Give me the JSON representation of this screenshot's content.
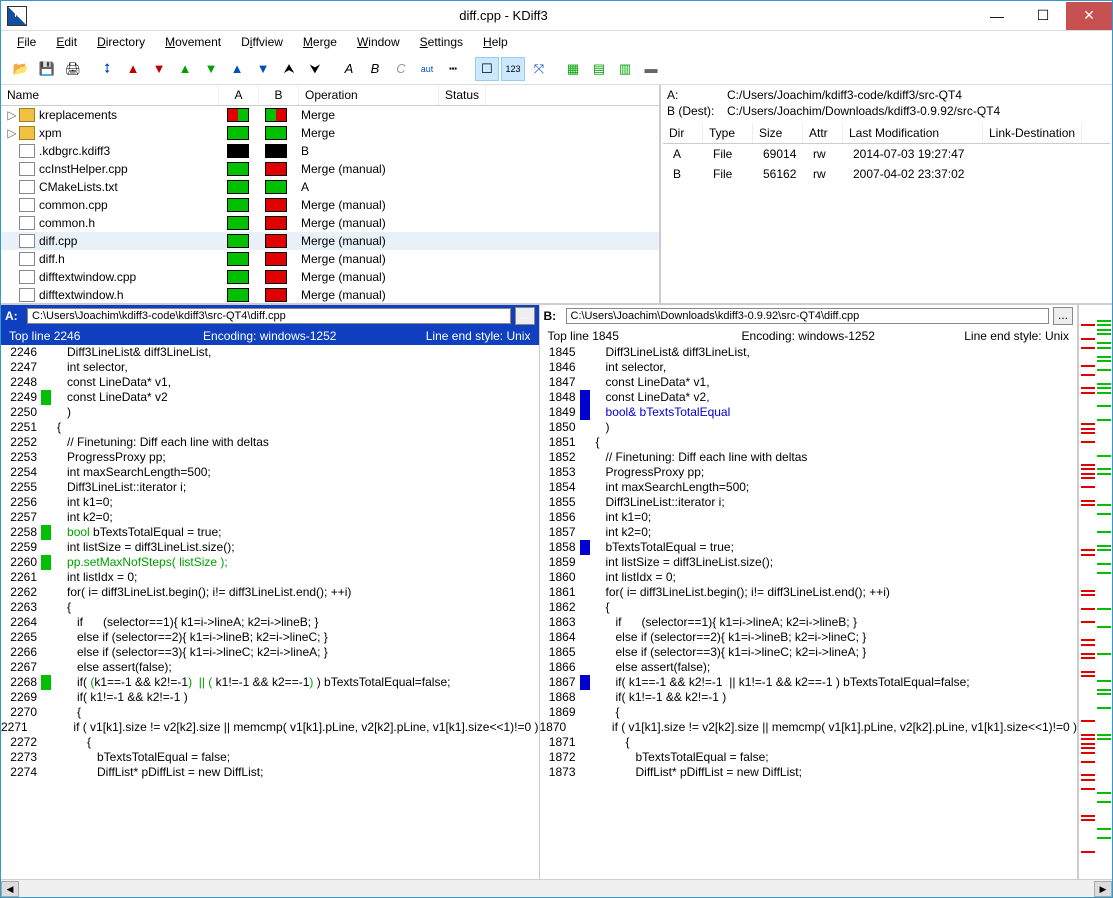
{
  "window": {
    "title": "diff.cpp - KDiff3"
  },
  "menus": [
    "File",
    "Edit",
    "Directory",
    "Movement",
    "Diffview",
    "Merge",
    "Window",
    "Settings",
    "Help"
  ],
  "tree": {
    "headers": {
      "name": "Name",
      "a": "A",
      "b": "B",
      "op": "Operation",
      "status": "Status"
    },
    "rows": [
      {
        "type": "folder",
        "exp": "▷",
        "name": "kreplacements",
        "a": "rg",
        "b": "gr",
        "op": "Merge"
      },
      {
        "type": "folder",
        "exp": "▷",
        "name": "xpm",
        "a": "green",
        "b": "green",
        "op": "Merge"
      },
      {
        "type": "file",
        "name": ".kdbgrc.kdiff3",
        "a": "black",
        "b": "black",
        "op": "B"
      },
      {
        "type": "file",
        "name": "ccInstHelper.cpp",
        "a": "green",
        "b": "red",
        "op": "Merge (manual)"
      },
      {
        "type": "file",
        "name": "CMakeLists.txt",
        "a": "green",
        "b": "green",
        "op": "A"
      },
      {
        "type": "file",
        "name": "common.cpp",
        "a": "green",
        "b": "red",
        "op": "Merge (manual)"
      },
      {
        "type": "file",
        "name": "common.h",
        "a": "green",
        "b": "red",
        "op": "Merge (manual)"
      },
      {
        "type": "file",
        "name": "diff.cpp",
        "a": "green",
        "b": "red",
        "op": "Merge (manual)",
        "selected": true
      },
      {
        "type": "file",
        "name": "diff.h",
        "a": "green",
        "b": "red",
        "op": "Merge (manual)"
      },
      {
        "type": "file",
        "name": "difftextwindow.cpp",
        "a": "green",
        "b": "red",
        "op": "Merge (manual)"
      },
      {
        "type": "file",
        "name": "difftextwindow.h",
        "a": "green",
        "b": "red",
        "op": "Merge (manual)"
      }
    ]
  },
  "info": {
    "a_label": "A:",
    "a_path": "C:/Users/Joachim/kdiff3-code/kdiff3/src-QT4",
    "b_label": "B (Dest):",
    "b_path": "C:/Users/Joachim/Downloads/kdiff3-0.9.92/src-QT4",
    "headers": {
      "dir": "Dir",
      "type": "Type",
      "size": "Size",
      "attr": "Attr",
      "mod": "Last Modification",
      "link": "Link-Destination"
    },
    "rows": [
      {
        "dir": "A",
        "type": "File",
        "size": "69014",
        "attr": "rw",
        "mod": "2014-07-03 19:27:47"
      },
      {
        "dir": "B",
        "type": "File",
        "size": "56162",
        "attr": "rw",
        "mod": "2007-04-02 23:37:02"
      }
    ]
  },
  "paneA": {
    "label": "A:",
    "path": "C:\\Users\\Joachim\\kdiff3-code\\kdiff3\\src-QT4\\diff.cpp",
    "topline": "Top line 2246",
    "encoding": "Encoding: windows-1252",
    "eol": "Line end style: Unix",
    "lines": [
      {
        "n": "2246",
        "m": "",
        "t": "   Diff3LineList& diff3LineList,"
      },
      {
        "n": "2247",
        "m": "",
        "t": "   int selector,"
      },
      {
        "n": "2248",
        "m": "",
        "t": "   const LineData* v1,"
      },
      {
        "n": "2249",
        "m": "g",
        "t": "   const LineData* v2"
      },
      {
        "n": "",
        "m": "g",
        "t": ""
      },
      {
        "n": "2250",
        "m": "",
        "t": "   )"
      },
      {
        "n": "2251",
        "m": "",
        "t": "{"
      },
      {
        "n": "2252",
        "m": "",
        "t": "   // Finetuning: Diff each line with deltas"
      },
      {
        "n": "2253",
        "m": "",
        "t": "   ProgressProxy pp;"
      },
      {
        "n": "2254",
        "m": "",
        "t": "   int maxSearchLength=500;"
      },
      {
        "n": "2255",
        "m": "",
        "t": "   Diff3LineList::iterator i;"
      },
      {
        "n": "2256",
        "m": "",
        "t": "   int k1=0;"
      },
      {
        "n": "2257",
        "m": "",
        "t": "   int k2=0;"
      },
      {
        "n": "2258",
        "m": "g",
        "t": "   <g>bool</g> bTextsTotalEqual = true;"
      },
      {
        "n": "2259",
        "m": "",
        "t": "   int listSize = diff3LineList.size();"
      },
      {
        "n": "2260",
        "m": "g",
        "t": "   <g>pp.setMaxNofSteps( listSize );</g>"
      },
      {
        "n": "2261",
        "m": "",
        "t": "   int listIdx = 0;"
      },
      {
        "n": "2262",
        "m": "",
        "t": "   for( i= diff3LineList.begin(); i!= diff3LineList.end(); ++i)"
      },
      {
        "n": "2263",
        "m": "",
        "t": "   {"
      },
      {
        "n": "2264",
        "m": "",
        "t": "      if      (selector==1){ k1=i->lineA; k2=i->lineB; }"
      },
      {
        "n": "2265",
        "m": "",
        "t": "      else if (selector==2){ k1=i->lineB; k2=i->lineC; }"
      },
      {
        "n": "2266",
        "m": "",
        "t": "      else if (selector==3){ k1=i->lineC; k2=i->lineA; }"
      },
      {
        "n": "2267",
        "m": "",
        "t": "      else assert(false);"
      },
      {
        "n": "2268",
        "m": "g",
        "t": "      if( <g>(</g>k1==-1 && k2!=-1<g>)  || (</g> k1!=-1 && k2==-1<g>)</g> ) bTextsTotalEqual=false;"
      },
      {
        "n": "2269",
        "m": "",
        "t": "      if( k1!=-1 && k2!=-1 )"
      },
      {
        "n": "2270",
        "m": "",
        "t": "      {"
      },
      {
        "n": "2271",
        "m": "",
        "t": "         if ( v1[k1].size != v2[k2].size || memcmp( v1[k1].pLine, v2[k2].pLine, v1[k1].size<<1)!=0 )"
      },
      {
        "n": "2272",
        "m": "",
        "t": "         {"
      },
      {
        "n": "2273",
        "m": "",
        "t": "            bTextsTotalEqual = false;"
      },
      {
        "n": "2274",
        "m": "",
        "t": "            DiffList* pDiffList = new DiffList;"
      }
    ]
  },
  "paneB": {
    "label": "B:",
    "path": "C:\\Users\\Joachim\\Downloads\\kdiff3-0.9.92\\src-QT4\\diff.cpp",
    "topline": "Top line 1845",
    "encoding": "Encoding: windows-1252",
    "eol": "Line end style: Unix",
    "lines": [
      {
        "n": "1845",
        "m": "",
        "t": "   Diff3LineList& diff3LineList,"
      },
      {
        "n": "1846",
        "m": "",
        "t": "   int selector,"
      },
      {
        "n": "1847",
        "m": "",
        "t": "   const LineData* v1,"
      },
      {
        "n": "1848",
        "m": "b",
        "t": "   const LineData* v2<b>,</b>"
      },
      {
        "n": "1849",
        "m": "b",
        "t": "   <b>bool& bTextsTotalEqual</b>"
      },
      {
        "n": "1850",
        "m": "",
        "t": "   )"
      },
      {
        "n": "1851",
        "m": "",
        "t": "{"
      },
      {
        "n": "1852",
        "m": "",
        "t": "   // Finetuning: Diff each line with deltas"
      },
      {
        "n": "1853",
        "m": "",
        "t": "   ProgressProxy pp;"
      },
      {
        "n": "1854",
        "m": "",
        "t": "   int maxSearchLength=500;"
      },
      {
        "n": "1855",
        "m": "",
        "t": "   Diff3LineList::iterator i;"
      },
      {
        "n": "1856",
        "m": "",
        "t": "   int k1=0;"
      },
      {
        "n": "1857",
        "m": "",
        "t": "   int k2=0;"
      },
      {
        "n": "1858",
        "m": "b",
        "t": "   bTextsTotalEqual = true;"
      },
      {
        "n": "1859",
        "m": "",
        "t": "   int listSize = diff3LineList.size();"
      },
      {
        "n": "",
        "m": "b",
        "t": ""
      },
      {
        "n": "1860",
        "m": "",
        "t": "   int listIdx = 0;"
      },
      {
        "n": "1861",
        "m": "",
        "t": "   for( i= diff3LineList.begin(); i!= diff3LineList.end(); ++i)"
      },
      {
        "n": "1862",
        "m": "",
        "t": "   {"
      },
      {
        "n": "1863",
        "m": "",
        "t": "      if      (selector==1){ k1=i->lineA; k2=i->lineB; }"
      },
      {
        "n": "1864",
        "m": "",
        "t": "      else if (selector==2){ k1=i->lineB; k2=i->lineC; }"
      },
      {
        "n": "1865",
        "m": "",
        "t": "      else if (selector==3){ k1=i->lineC; k2=i->lineA; }"
      },
      {
        "n": "1866",
        "m": "",
        "t": "      else assert(false);"
      },
      {
        "n": "1867",
        "m": "b",
        "t": "      if( k1==-1 && k2!=-1  || k1!=-1 && k2==-1 ) bTextsTotalEqual=false;"
      },
      {
        "n": "1868",
        "m": "",
        "t": "      if( k1!=-1 && k2!=-1 )"
      },
      {
        "n": "1869",
        "m": "",
        "t": "      {"
      },
      {
        "n": "1870",
        "m": "",
        "t": "         if ( v1[k1].size != v2[k2].size || memcmp( v1[k1].pLine, v2[k2].pLine, v1[k1].size<<1)!=0 )"
      },
      {
        "n": "1871",
        "m": "",
        "t": "         {"
      },
      {
        "n": "1872",
        "m": "",
        "t": "            bTextsTotalEqual = false;"
      },
      {
        "n": "1873",
        "m": "",
        "t": "            DiffList* pDiffList = new DiffList;"
      }
    ]
  }
}
